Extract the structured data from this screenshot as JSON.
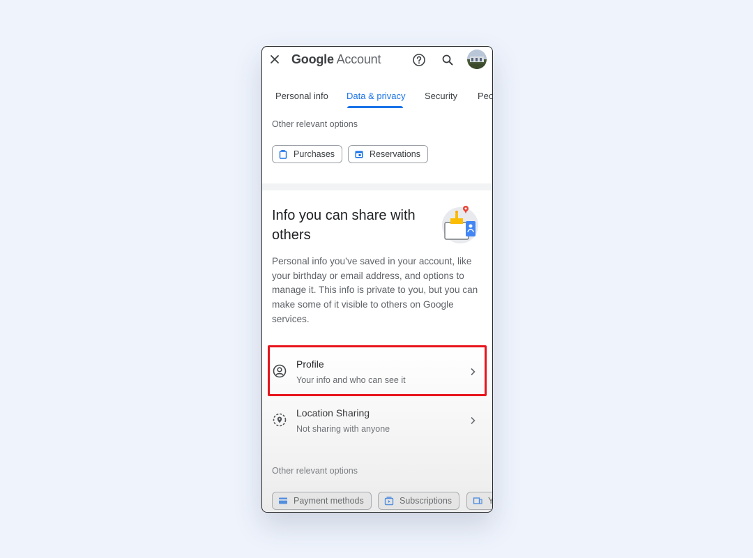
{
  "header": {
    "brand": "Google",
    "title": "Account"
  },
  "tabs": [
    {
      "label": "Personal info",
      "active": false
    },
    {
      "label": "Data & privacy",
      "active": true
    },
    {
      "label": "Security",
      "active": false
    },
    {
      "label": "Peo",
      "active": false
    }
  ],
  "top_section": {
    "label": "Other relevant options",
    "chips": [
      {
        "label": "Purchases",
        "icon": "purchases-icon"
      },
      {
        "label": "Reservations",
        "icon": "calendar-icon"
      }
    ]
  },
  "info_section": {
    "title": "Info you can share with others",
    "description": "Personal info you’ve saved in your account, like your birthday or email address, and options to manage it. This info is private to you, but you can make some of it visible to others on Google services.",
    "items": [
      {
        "title": "Profile",
        "subtitle": "Your info and who can see it",
        "icon": "profile-icon",
        "highlighted": true
      },
      {
        "title": "Location Sharing",
        "subtitle": "Not sharing with anyone",
        "icon": "location-sharing-icon",
        "highlighted": false
      }
    ]
  },
  "bottom_section": {
    "label": "Other relevant options",
    "chips": [
      {
        "label": "Payment methods",
        "icon": "payment-icon"
      },
      {
        "label": "Subscriptions",
        "icon": "subscriptions-icon"
      },
      {
        "label": "Y",
        "icon": "devices-icon"
      }
    ]
  },
  "colors": {
    "accent": "#1a73e8",
    "highlight": "#e8141c",
    "background": "#eef3fc"
  }
}
